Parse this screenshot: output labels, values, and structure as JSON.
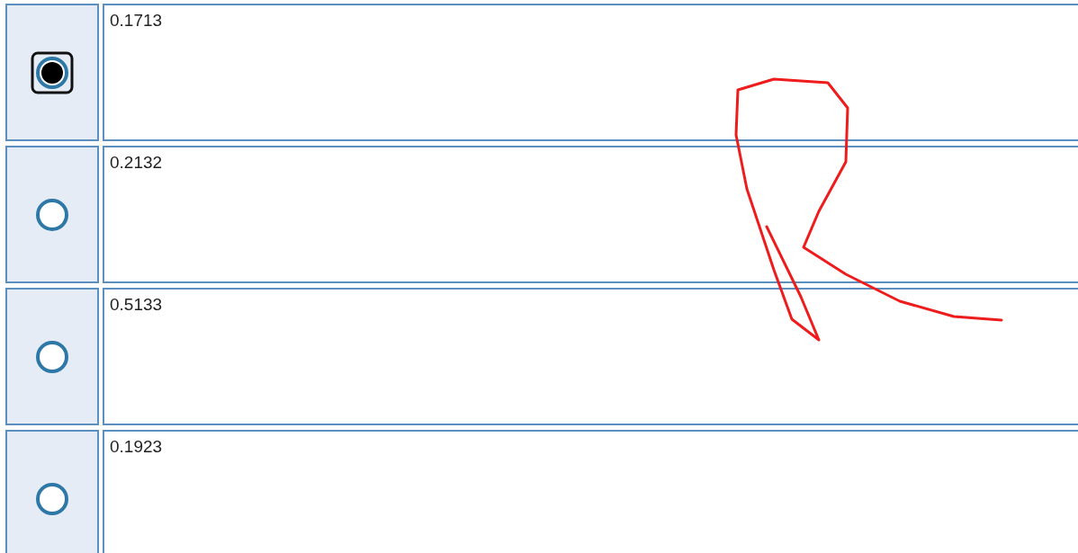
{
  "rows": [
    {
      "value": "0.1713",
      "selected": true
    },
    {
      "value": "0.2132",
      "selected": false
    },
    {
      "value": "0.5133",
      "selected": false
    },
    {
      "value": "0.1923",
      "selected": false
    }
  ]
}
